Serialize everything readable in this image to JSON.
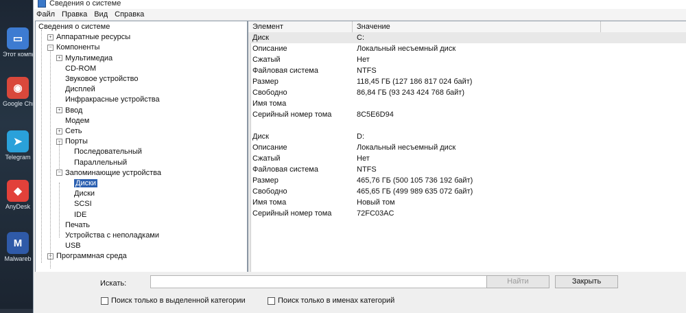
{
  "window": {
    "title": "Сведения о системе",
    "menu": [
      "Файл",
      "Правка",
      "Вид",
      "Справка"
    ]
  },
  "desktop_icons": [
    {
      "name": "this-pc-icon",
      "label": "Этот компьютер",
      "glyph": "▭",
      "color": "#3d7bd1"
    },
    {
      "name": "chrome-icon",
      "label": "Google Chrome",
      "glyph": "◉",
      "color": "#d9483b"
    },
    {
      "name": "telegram-icon",
      "label": "Telegram",
      "glyph": "➤",
      "color": "#2aa1da"
    },
    {
      "name": "anydesk-icon",
      "label": "AnyDesk",
      "glyph": "◆",
      "color": "#e2413a"
    },
    {
      "name": "malwarebytes-icon",
      "label": "Malwareb",
      "glyph": "M",
      "color": "#2f5aa8"
    }
  ],
  "tree": [
    {
      "label": "Сведения о системе",
      "level": 0,
      "expander": ""
    },
    {
      "label": "Аппаратные ресурсы",
      "level": 1,
      "expander": "+"
    },
    {
      "label": "Компоненты",
      "level": 1,
      "expander": "−"
    },
    {
      "label": "Мультимедиа",
      "level": 2,
      "expander": "+"
    },
    {
      "label": "CD-ROM",
      "level": 2,
      "expander": ""
    },
    {
      "label": "Звуковое устройство",
      "level": 2,
      "expander": ""
    },
    {
      "label": "Дисплей",
      "level": 2,
      "expander": ""
    },
    {
      "label": "Инфракрасные устройства",
      "level": 2,
      "expander": ""
    },
    {
      "label": "Ввод",
      "level": 2,
      "expander": "+"
    },
    {
      "label": "Модем",
      "level": 2,
      "expander": ""
    },
    {
      "label": "Сеть",
      "level": 2,
      "expander": "+"
    },
    {
      "label": "Порты",
      "level": 2,
      "expander": "−"
    },
    {
      "label": "Последовательный",
      "level": 3,
      "expander": ""
    },
    {
      "label": "Параллельный",
      "level": 3,
      "expander": ""
    },
    {
      "label": "Запоминающие устройства",
      "level": 2,
      "expander": "−"
    },
    {
      "label": "Диски",
      "level": 3,
      "expander": "",
      "selected": true
    },
    {
      "label": "Диски",
      "level": 3,
      "expander": ""
    },
    {
      "label": "SCSI",
      "level": 3,
      "expander": ""
    },
    {
      "label": "IDE",
      "level": 3,
      "expander": ""
    },
    {
      "label": "Печать",
      "level": 2,
      "expander": ""
    },
    {
      "label": "Устройства с неполадками",
      "level": 2,
      "expander": ""
    },
    {
      "label": "USB",
      "level": 2,
      "expander": ""
    },
    {
      "label": "Программная среда",
      "level": 1,
      "expander": "+"
    }
  ],
  "table": {
    "col_element": "Элемент",
    "col_value": "Значение",
    "rows": [
      [
        "Диск",
        "C:"
      ],
      [
        "Описание",
        "Локальный несъемный диск"
      ],
      [
        "Сжатый",
        "Нет"
      ],
      [
        "Файловая система",
        "NTFS"
      ],
      [
        "Размер",
        "118,45 ГБ (127 186 817 024 байт)"
      ],
      [
        "Свободно",
        "86,84 ГБ (93 243 424 768 байт)"
      ],
      [
        "Имя тома",
        ""
      ],
      [
        "Серийный номер тома",
        "8C5E6D94"
      ],
      [
        "",
        ""
      ],
      [
        "Диск",
        "D:"
      ],
      [
        "Описание",
        "Локальный несъемный диск"
      ],
      [
        "Сжатый",
        "Нет"
      ],
      [
        "Файловая система",
        "NTFS"
      ],
      [
        "Размер",
        "465,76 ГБ (500 105 736 192 байт)"
      ],
      [
        "Свободно",
        "465,65 ГБ (499 989 635 072 байт)"
      ],
      [
        "Имя тома",
        "Новый том"
      ],
      [
        "Серийный номер тома",
        "72FC03AC"
      ]
    ]
  },
  "search": {
    "label": "Искать:",
    "value": "",
    "find_button": "Найти",
    "close_button": "Закрыть",
    "check_selected": "Поиск только в выделенной категории",
    "check_names": "Поиск только в именах категорий"
  }
}
